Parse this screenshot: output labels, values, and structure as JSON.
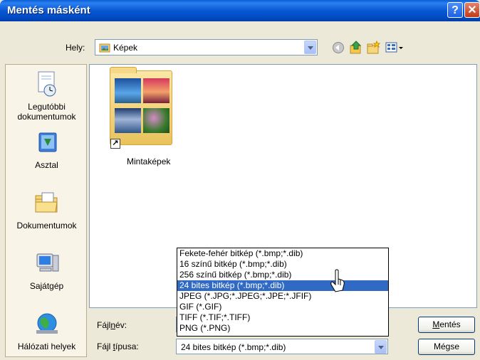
{
  "window": {
    "title": "Mentés másként"
  },
  "location": {
    "label": "Hely:",
    "value": "Képek"
  },
  "sidebar": {
    "items": [
      {
        "label_line1": "Legutóbbi",
        "label_line2": "dokumentumok",
        "icon": "recent-documents-icon"
      },
      {
        "label_line1": "Asztal",
        "label_line2": "",
        "icon": "desktop-icon"
      },
      {
        "label_line1": "Dokumentumok",
        "label_line2": "",
        "icon": "my-documents-icon"
      },
      {
        "label_line1": "Sajátgép",
        "label_line2": "",
        "icon": "my-computer-icon"
      },
      {
        "label_line1": "Hálózati helyek",
        "label_line2": "",
        "icon": "network-places-icon"
      }
    ]
  },
  "files": [
    {
      "label": "Mintaképek",
      "icon": "folder-icon"
    }
  ],
  "filename": {
    "label": "Fájlnév:",
    "value": ""
  },
  "filetype": {
    "label": "Fájl típusa:",
    "value": "24 bites bitkép (*.bmp;*.dib)",
    "options": [
      "Fekete-fehér bitkép (*.bmp;*.dib)",
      "16 színű bitkép (*.bmp;*.dib)",
      "256 színű bitkép (*.bmp;*.dib)",
      "24 bites bitkép (*.bmp;*.dib)",
      "JPEG (*.JPG;*.JPEG;*.JPE;*.JFIF)",
      "GIF (*.GIF)",
      "TIFF (*.TIF;*.TIFF)",
      "PNG (*.PNG)"
    ],
    "selected_index": 3
  },
  "buttons": {
    "save": "Mentés",
    "cancel": "Mégse"
  },
  "titlebar_buttons": {
    "help": "?",
    "close": "✕"
  }
}
